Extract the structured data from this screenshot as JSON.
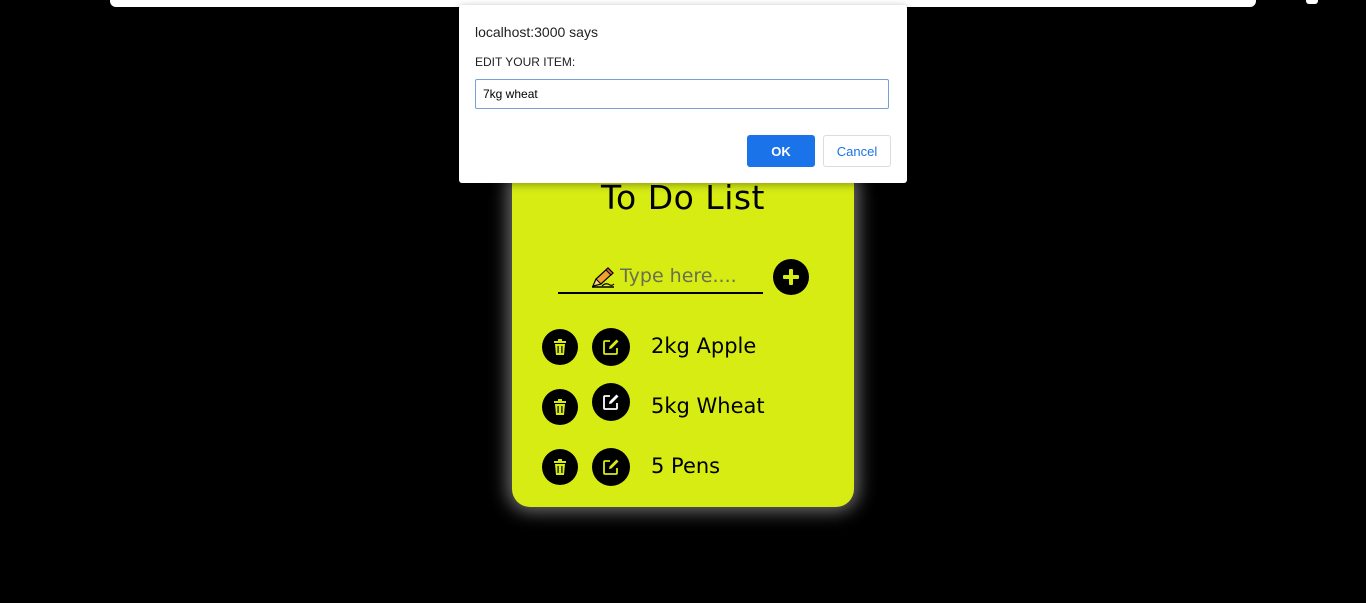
{
  "colors": {
    "background": "#000000",
    "card": "#d6ec13",
    "accent_icon": "#d6ec13",
    "dialog_primary": "#1a73e8"
  },
  "app": {
    "title": "To Do List",
    "input_placeholder": "Type here....",
    "input_icon": "pencil-icon",
    "add_icon": "plus-icon",
    "items": [
      {
        "label": "2kg Apple",
        "delete_icon": "trash-icon",
        "edit_icon": "edit-icon"
      },
      {
        "label": "5kg Wheat",
        "delete_icon": "trash-icon",
        "edit_icon": "edit-icon"
      },
      {
        "label": "5 Pens",
        "delete_icon": "trash-icon",
        "edit_icon": "edit-icon"
      }
    ]
  },
  "dialog": {
    "title": "localhost:3000 says",
    "message": "EDIT YOUR ITEM:",
    "input_value": "7kg wheat",
    "ok_label": "OK",
    "cancel_label": "Cancel"
  }
}
